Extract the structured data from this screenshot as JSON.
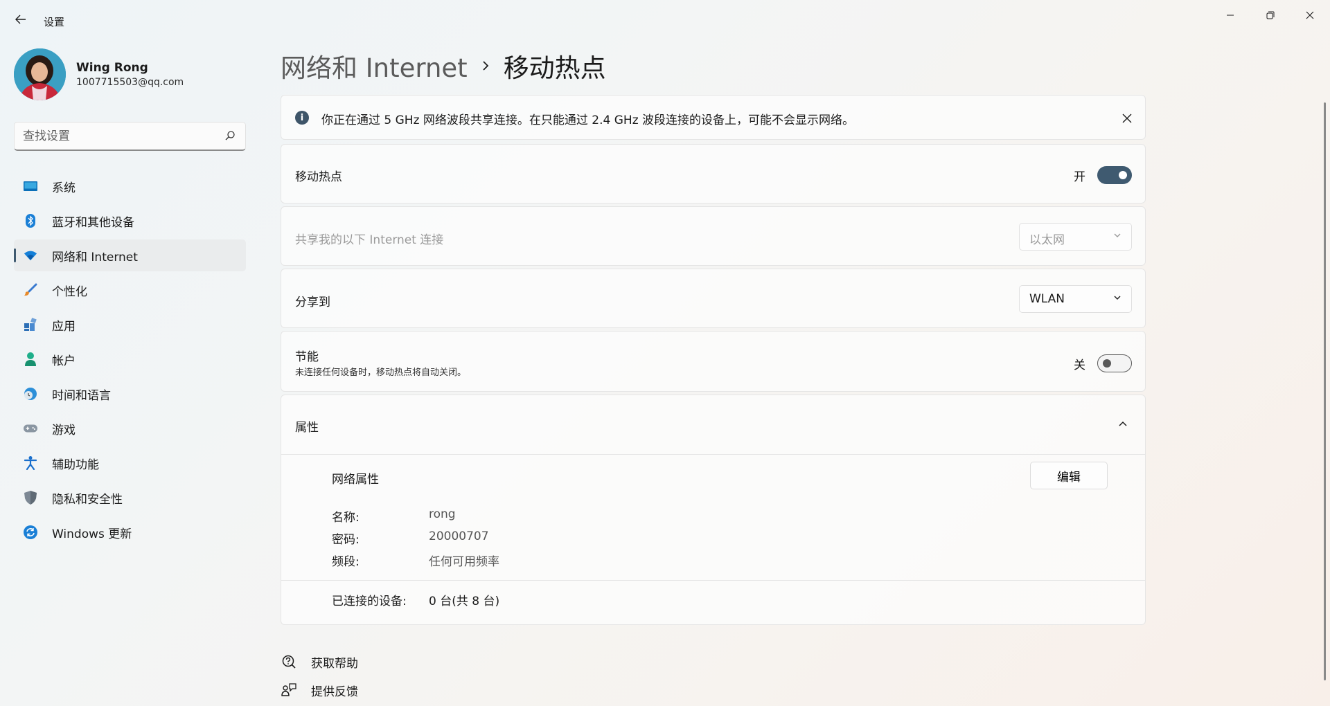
{
  "window": {
    "title": "设置"
  },
  "profile": {
    "name": "Wing Rong",
    "email": "1007715503@qq.com"
  },
  "search": {
    "placeholder": "查找设置"
  },
  "nav": [
    {
      "label": "系统",
      "icon": "monitor-icon"
    },
    {
      "label": "蓝牙和其他设备",
      "icon": "bluetooth-icon"
    },
    {
      "label": "网络和 Internet",
      "icon": "wifi-icon",
      "selected": true
    },
    {
      "label": "个性化",
      "icon": "brush-icon"
    },
    {
      "label": "应用",
      "icon": "apps-icon"
    },
    {
      "label": "帐户",
      "icon": "account-icon"
    },
    {
      "label": "时间和语言",
      "icon": "globe-clock-icon"
    },
    {
      "label": "游戏",
      "icon": "gamepad-icon"
    },
    {
      "label": "辅助功能",
      "icon": "accessibility-icon"
    },
    {
      "label": "隐私和安全性",
      "icon": "shield-icon"
    },
    {
      "label": "Windows 更新",
      "icon": "update-icon"
    }
  ],
  "breadcrumb": {
    "parent": "网络和 Internet",
    "current": "移动热点"
  },
  "info_bar": {
    "text": "你正在通过 5 GHz 网络波段共享连接。在只能通过 2.4 GHz 波段连接的设备上，可能不会显示网络。"
  },
  "hotspot": {
    "label": "移动热点",
    "state": "开"
  },
  "share_from": {
    "label": "共享我的以下 Internet 连接",
    "value": "以太网"
  },
  "share_to": {
    "label": "分享到",
    "value": "WLAN"
  },
  "power_saving": {
    "label": "节能",
    "description": "未连接任何设备时，移动热点将自动关闭。",
    "state": "关"
  },
  "properties": {
    "title": "属性",
    "network_props_title": "网络属性",
    "edit_label": "编辑",
    "items": [
      {
        "key": "名称:",
        "value": "rong"
      },
      {
        "key": "密码:",
        "value": "20000707"
      },
      {
        "key": "频段:",
        "value": "任何可用频率"
      }
    ],
    "connected": {
      "key": "已连接的设备:",
      "value": "0 台(共 8 台)"
    }
  },
  "footer": {
    "help": "获取帮助",
    "feedback": "提供反馈"
  },
  "colors": {
    "accent": "#3f5a70"
  }
}
